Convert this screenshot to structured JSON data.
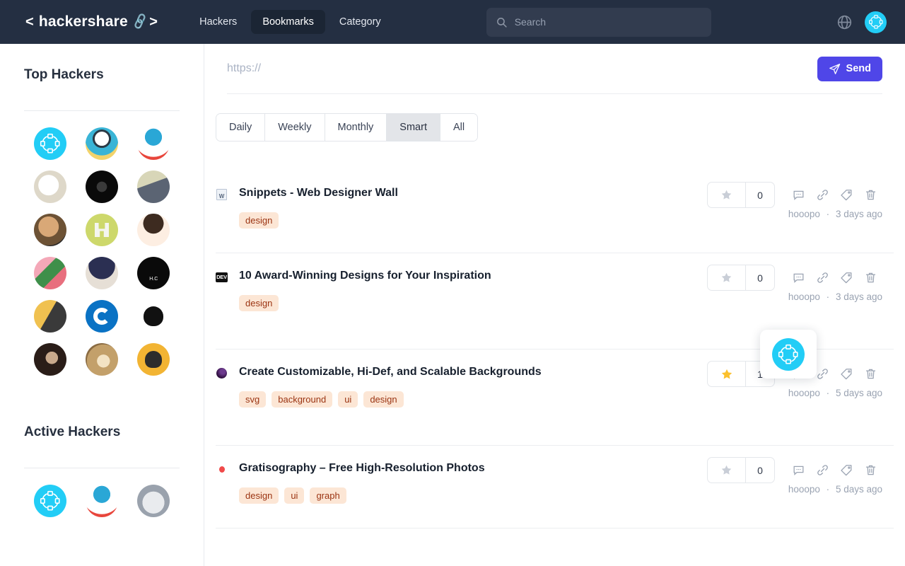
{
  "header": {
    "brand": {
      "left_angle": "<",
      "name": "hackershare",
      "right_angle": ">",
      "link_icon": "link-glyph-icon"
    },
    "nav": [
      {
        "label": "Hackers",
        "active": false
      },
      {
        "label": "Bookmarks",
        "active": true
      },
      {
        "label": "Category",
        "active": false
      }
    ],
    "search": {
      "placeholder": "Search",
      "value": "",
      "icon": "search-icon"
    },
    "globe_icon": "globe-icon",
    "user_avatar": "user-avatar-hackershare-logo",
    "colors": {
      "bar_bg": "#242f42",
      "active_nav_bg": "#1b2534",
      "avatar_cyan": "#22cdf6"
    }
  },
  "sidebar": {
    "top_hackers": {
      "title": "Top Hackers",
      "avatars": [
        "hackershare-logo-cyan",
        "panda-bee-illustration",
        "doraemon-cartoon",
        "sketch-face-beige",
        "black-drone-photo",
        "bearded-man-photo",
        "anime-painted-man",
        "green-pixel-logo",
        "anime-girl-shy",
        "watermelon-girl-photo",
        "anime-dark-hair",
        "black-bull-hc-logo",
        "yellow-poster-portrait",
        "blue-circle-g-logo",
        "black-ninja-icon",
        "man-in-suit-photo",
        "nautilus-shell-photo",
        "yellow-anonymous-icon"
      ]
    },
    "active_hackers": {
      "title": "Active Hackers",
      "avatars": [
        "hackershare-logo-cyan",
        "doraemon-cartoon",
        "grey-car-photo"
      ]
    }
  },
  "main": {
    "url_bar": {
      "placeholder": "https://",
      "value": ""
    },
    "send_button": {
      "label": "Send",
      "icon": "paper-plane-icon",
      "color": "#4f46e8"
    },
    "tabs": [
      {
        "label": "Daily",
        "active": false
      },
      {
        "label": "Weekly",
        "active": false
      },
      {
        "label": "Monthly",
        "active": false
      },
      {
        "label": "Smart",
        "active": true
      },
      {
        "label": "All",
        "active": false
      }
    ],
    "action_icons": [
      "comment-icon",
      "link-icon",
      "tag-icon",
      "trash-icon"
    ],
    "bookmarks": [
      {
        "favicon": "broken-image-w-icon",
        "title": "Snippets - Web Designer Wall",
        "tags": [
          "design"
        ],
        "starred": false,
        "star_count": "0",
        "author": "hooopo",
        "time": "3 days ago"
      },
      {
        "favicon": "dev-black-badge-icon",
        "title": "10 Award-Winning Designs for Your Inspiration",
        "tags": [
          "design"
        ],
        "starred": false,
        "star_count": "0",
        "author": "hooopo",
        "time": "3 days ago"
      },
      {
        "favicon": "purple-circle-icon",
        "title": "Create Customizable, Hi-Def, and Scalable Backgrounds",
        "tags": [
          "svg",
          "background",
          "ui",
          "design"
        ],
        "starred": true,
        "star_count": "1",
        "author": "hooopo",
        "time": "5 days ago"
      },
      {
        "favicon": "red-dot-icon",
        "title": "Gratisography – Free High-Resolution Photos",
        "tags": [
          "design",
          "ui",
          "graph"
        ],
        "starred": false,
        "star_count": "0",
        "author": "hooopo",
        "time": "5 days ago"
      }
    ],
    "popover": {
      "avatar": "hackershare-logo-cyan"
    }
  }
}
